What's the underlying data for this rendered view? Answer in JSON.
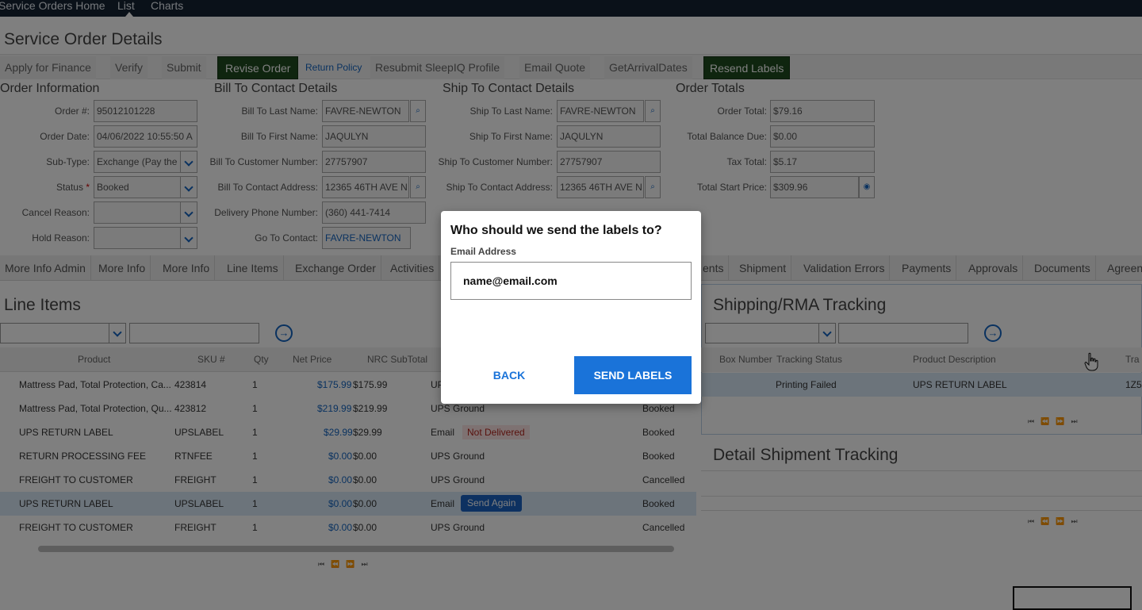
{
  "nav": {
    "items": [
      "Service Orders Home",
      "List",
      "Charts"
    ]
  },
  "page_title": "Service Order Details",
  "toolbar": {
    "apply_finance": "Apply for Finance",
    "verify": "Verify",
    "submit": "Submit",
    "revise_order": "Revise Order",
    "return_policy": "Return Policy",
    "resubmit_sleepiq": "Resubmit SleepIQ Profile",
    "email_quote": "Email Quote",
    "get_arrival_dates": "GetArrivalDates",
    "resend_labels": "Resend Labels"
  },
  "order_info": {
    "title": "Order Information",
    "order_no_label": "Order #:",
    "order_no": "95012101228",
    "order_date_label": "Order Date:",
    "order_date": "04/06/2022 10:55:50 A",
    "subtype_label": "Sub-Type:",
    "subtype": "Exchange (Pay the",
    "status_label": "Status",
    "status_req": "*",
    "status": "Booked",
    "cancel_reason_label": "Cancel Reason:",
    "hold_reason_label": "Hold Reason:"
  },
  "bill_to": {
    "title": "Bill To Contact Details",
    "last_name_label": "Bill To Last Name:",
    "last_name": "FAVRE-NEWTON",
    "first_name_label": "Bill To First Name:",
    "first_name": "JAQULYN",
    "customer_number_label": "Bill To Customer Number:",
    "customer_number": "27757907",
    "address_label": "Bill To Contact Address:",
    "address": "12365 46TH AVE N",
    "phone_label": "Delivery Phone Number:",
    "phone": "(360) 441-7414",
    "goto_label": "Go To Contact:",
    "goto": "FAVRE-NEWTON"
  },
  "ship_to": {
    "title": "Ship To Contact Details",
    "last_name_label": "Ship To Last Name:",
    "last_name": "FAVRE-NEWTON",
    "first_name_label": "Ship To First Name:",
    "first_name": "JAQULYN",
    "customer_number_label": "Ship To Customer Number:",
    "customer_number": "27757907",
    "address_label": "Ship To Contact Address:",
    "address": "12365 46TH AVE N"
  },
  "order_totals": {
    "title": "Order Totals",
    "order_total_label": "Order Total:",
    "order_total": "$79.16",
    "balance_due_label": "Total Balance Due:",
    "balance_due": "$0.00",
    "tax_total_label": "Tax Total:",
    "tax_total": "$5.17",
    "start_price_label": "Total Start Price:",
    "start_price": "$309.96"
  },
  "tabs": [
    "More Info Admin",
    "More Info",
    "More Info",
    "Line Items",
    "Exchange Order",
    "Activities",
    "ents",
    "Shipment",
    "Validation Errors",
    "Payments",
    "Approvals",
    "Documents",
    "Agreen"
  ],
  "line_items": {
    "title": "Line Items",
    "columns": [
      "Product",
      "SKU #",
      "Qty",
      "Net Price",
      "NRC SubTotal"
    ],
    "rows": [
      {
        "product": "Mattress Pad, Total Protection, Ca...",
        "sku": "423814",
        "qty": "1",
        "net": "$175.99",
        "sub": "$175.99",
        "ship": "UP",
        "status": ""
      },
      {
        "product": "Mattress Pad, Total Protection, Qu...",
        "sku": "423812",
        "qty": "1",
        "net": "$219.99",
        "sub": "$219.99",
        "ship": "UPS Ground",
        "status": "Booked"
      },
      {
        "product": "UPS RETURN LABEL",
        "sku": "UPSLABEL",
        "qty": "1",
        "net": "$29.99",
        "sub": "$29.99",
        "ship": "Email",
        "badge": "Not Delivered",
        "status": "Booked"
      },
      {
        "product": "RETURN PROCESSING FEE",
        "sku": "RTNFEE",
        "qty": "1",
        "net": "$0.00",
        "sub": "$0.00",
        "ship": "UPS Ground",
        "status": "Booked"
      },
      {
        "product": "FREIGHT TO CUSTOMER",
        "sku": "FREIGHT",
        "qty": "1",
        "net": "$0.00",
        "sub": "$0.00",
        "ship": "UPS Ground",
        "status": "Cancelled"
      },
      {
        "product": "UPS RETURN LABEL",
        "sku": "UPSLABEL",
        "qty": "1",
        "net": "$0.00",
        "sub": "$0.00",
        "ship": "Email",
        "button": "Send Again",
        "status": "Booked"
      },
      {
        "product": "FREIGHT TO CUSTOMER",
        "sku": "FREIGHT",
        "qty": "1",
        "net": "$0.00",
        "sub": "$0.00",
        "ship": "UPS Ground",
        "status": "Cancelled"
      }
    ]
  },
  "shipping": {
    "title": "Shipping/RMA Tracking",
    "columns": [
      "Box Number",
      "Tracking Status",
      "Product Description",
      "Tra"
    ],
    "row": {
      "tracking_status": "Printing Failed",
      "description": "UPS RETURN LABEL",
      "tracking": "1Z5"
    }
  },
  "detail_tracking": {
    "title": "Detail Shipment Tracking"
  },
  "pager_glyphs": "⏮⏪⏩⏭",
  "modal": {
    "title": "Who should we send the labels to?",
    "email_label": "Email Address",
    "email_value": "name@email.com",
    "back": "BACK",
    "send": "SEND LABELS"
  },
  "colors": {
    "nav_bg": "#152233",
    "accent": "#1a73d9",
    "dark_button": "#1e4a1e"
  }
}
